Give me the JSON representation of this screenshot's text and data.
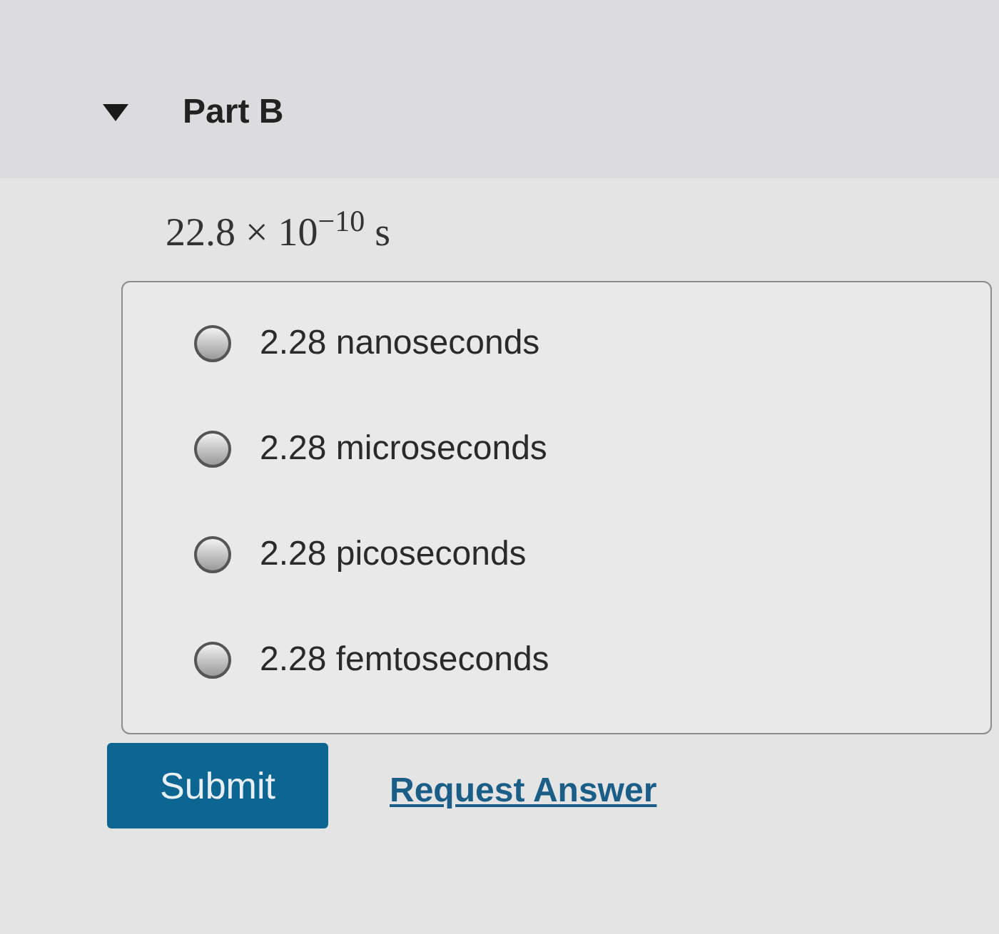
{
  "part": {
    "title": "Part B",
    "expanded": true
  },
  "question": "22.8 × 10$^{−10}$ s",
  "options": [
    {
      "label": "2.28 nanoseconds",
      "selected": false
    },
    {
      "label": "2.28 microseconds",
      "selected": false
    },
    {
      "label": "2.28 picoseconds",
      "selected": false
    },
    {
      "label": "2.28 femtoseconds",
      "selected": false
    }
  ],
  "actions": {
    "submit": "Submit",
    "request": "Request Answer"
  }
}
